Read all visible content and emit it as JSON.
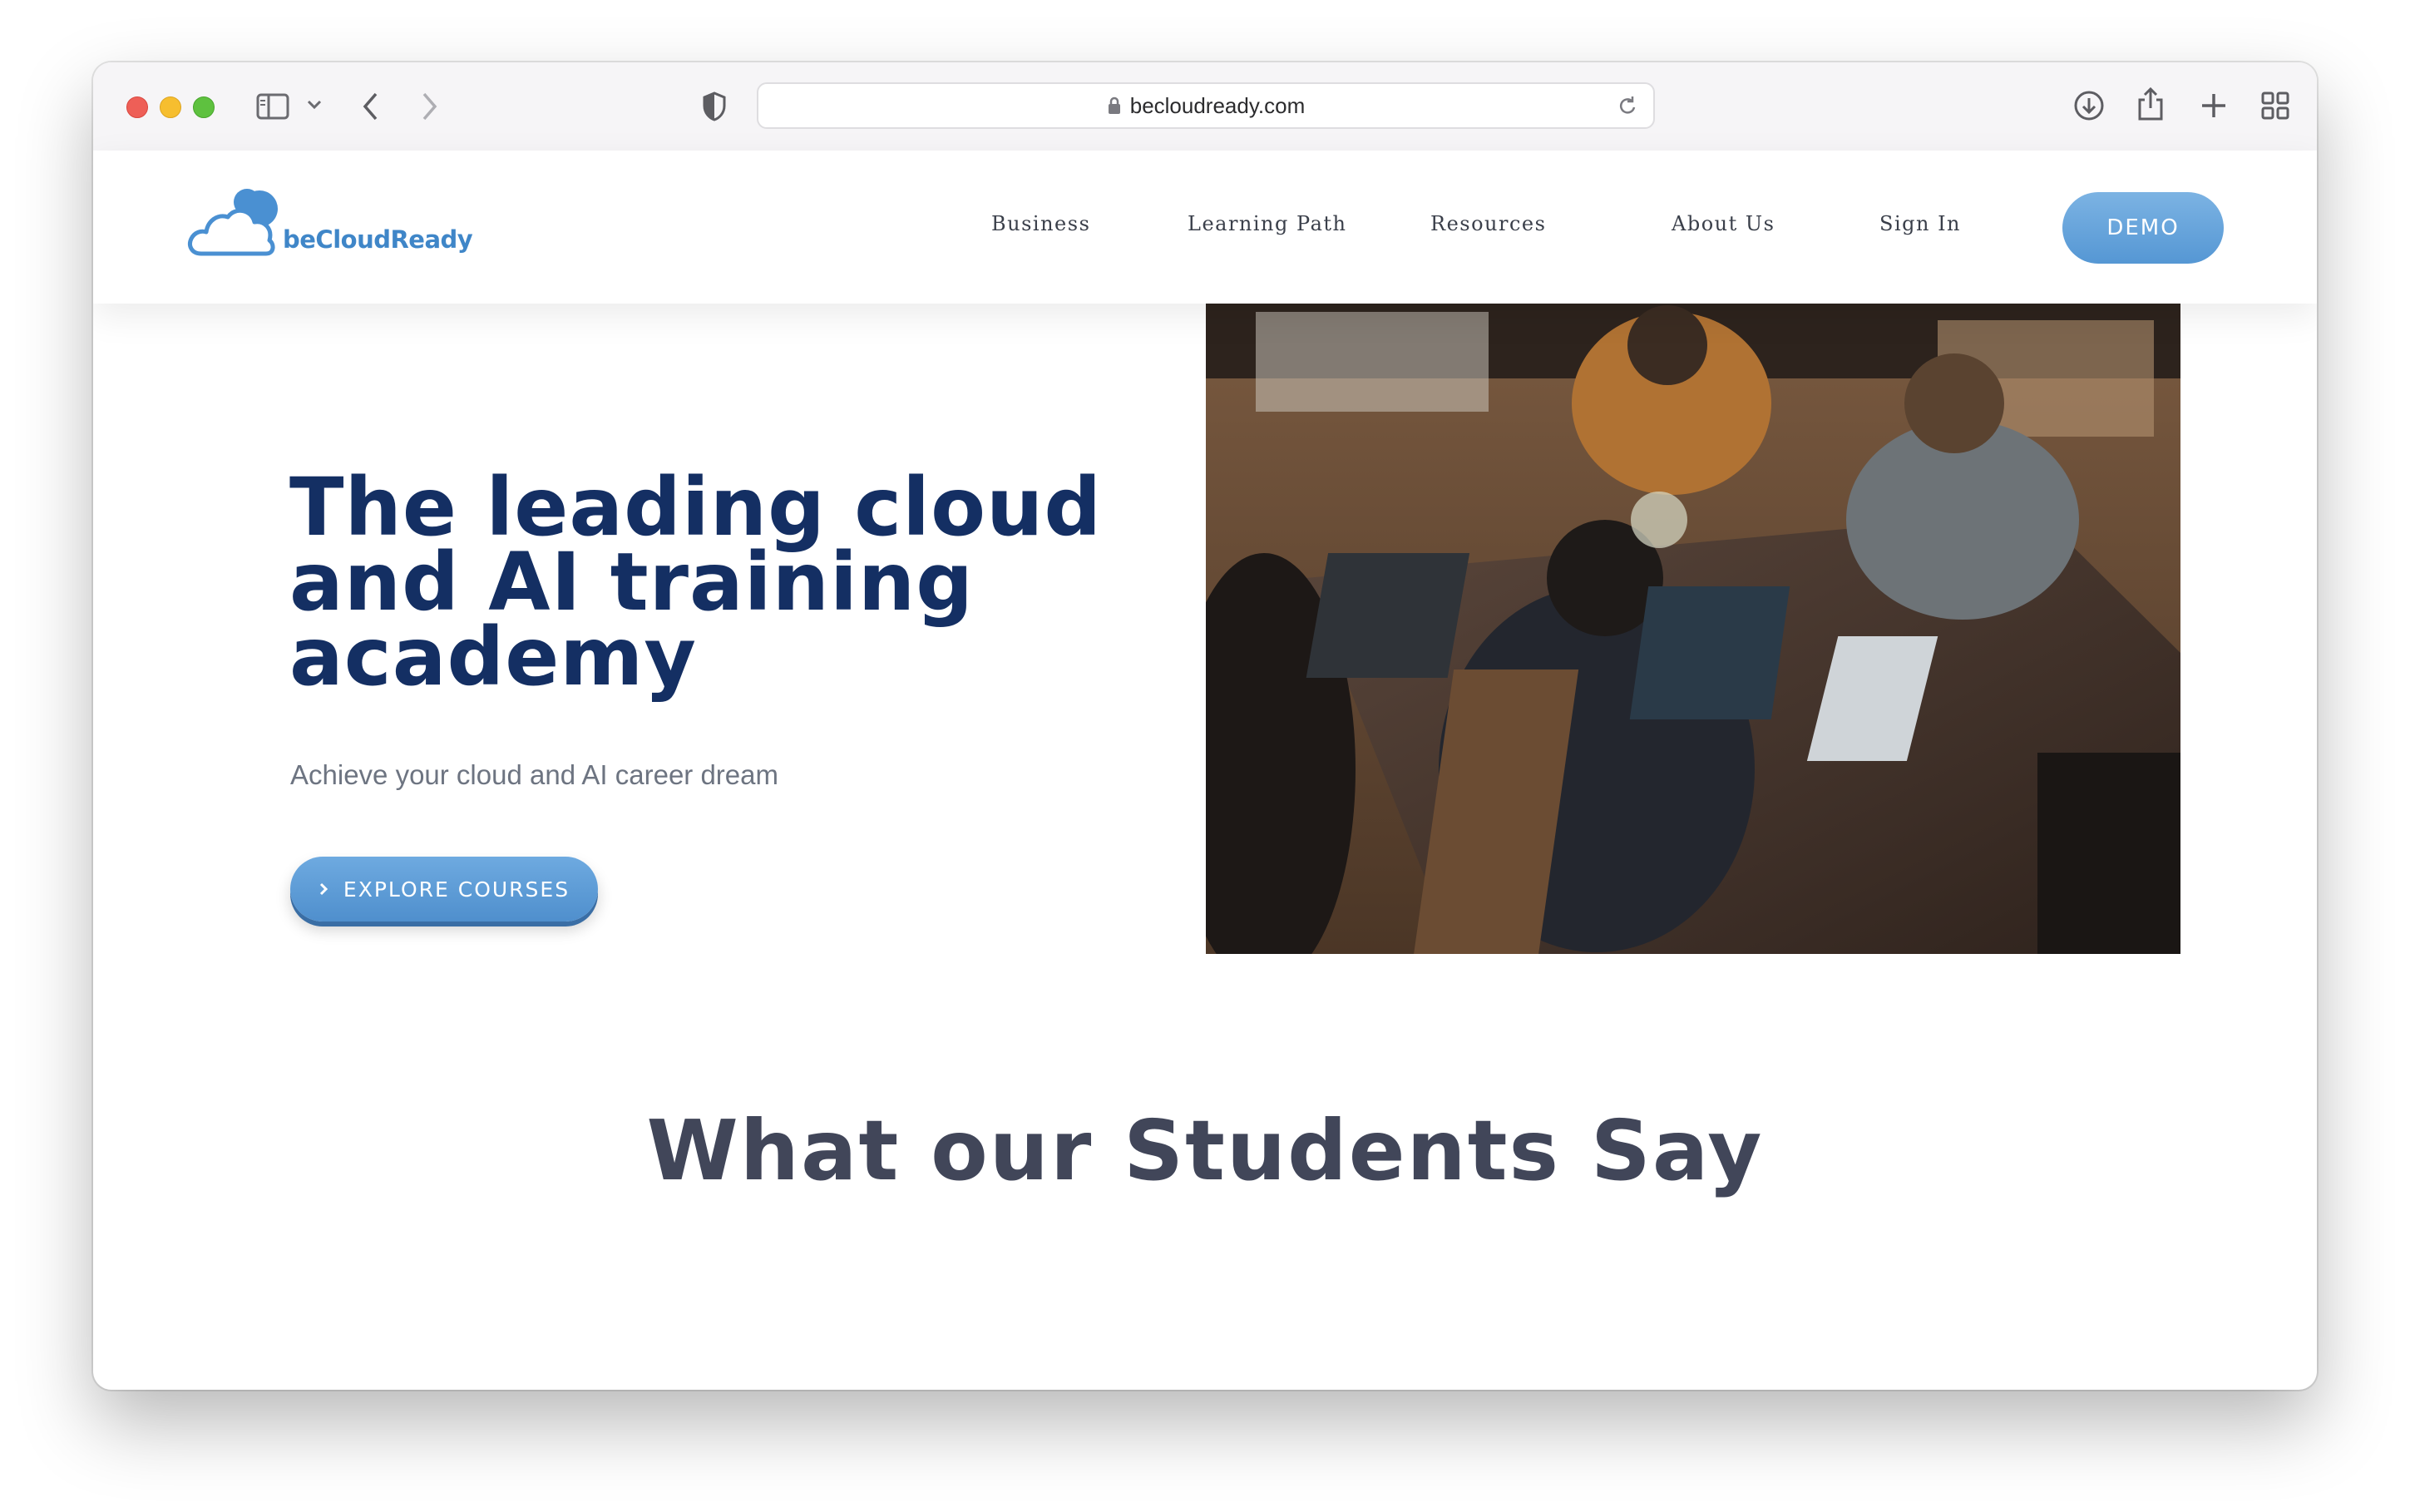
{
  "browser": {
    "url": "becloudready.com"
  },
  "site": {
    "logo_text": "beCloudReady",
    "nav": [
      {
        "label": "Business"
      },
      {
        "label": "Learning Path"
      },
      {
        "label": "Resources"
      },
      {
        "label": "About Us"
      },
      {
        "label": "Sign In"
      }
    ],
    "demo_label": "DEMO"
  },
  "hero": {
    "title": "The leading cloud and AI training academy",
    "subtitle": "Achieve your cloud and AI career dream",
    "cta_label": "EXPLORE COURSES"
  },
  "testimonials": {
    "title": "What our Students Say"
  },
  "colors": {
    "brand_blue": "#3f86c8",
    "heading_navy": "#142f63",
    "button_blue": "#5a9ad6",
    "section_heading": "#414659"
  }
}
